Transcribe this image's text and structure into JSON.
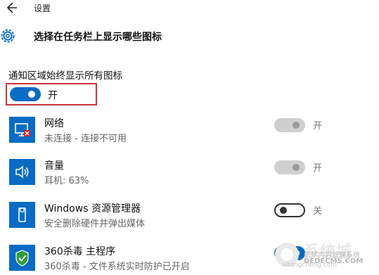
{
  "topbar": {
    "title": "设置"
  },
  "header": {
    "title": "选择在任务栏上显示哪些图标"
  },
  "notification": {
    "heading": "通知区域始终显示所有图标",
    "toggle_state": "开",
    "toggle_on": true
  },
  "items": [
    {
      "name": "网络",
      "status": "未连接 - 连接不可用",
      "state": "开",
      "toggle": "disabled",
      "icon": "network-icon"
    },
    {
      "name": "音量",
      "status": "耳机: 63%",
      "state": "开",
      "toggle": "disabled",
      "icon": "volume-icon"
    },
    {
      "name": "Windows 资源管理器",
      "status": "安全删除硬件并弹出媒体",
      "state": "关",
      "toggle": "off",
      "icon": "usb-drive-icon"
    },
    {
      "name": "360杀毒 主程序",
      "status": "360杀毒 - 文件系统实时防护已开启",
      "state": "",
      "toggle": "on",
      "icon": "shield-icon"
    }
  ],
  "watermark": {
    "big_text": "系统城",
    "line1": "织梦内容管理系统",
    "line2": "DEDECMS.COM",
    "line3": "xitongcheng.com"
  },
  "colors": {
    "accent": "#0a6bc4",
    "highlight_border": "#c9353a",
    "disabled_toggle": "#cfcfcf"
  }
}
